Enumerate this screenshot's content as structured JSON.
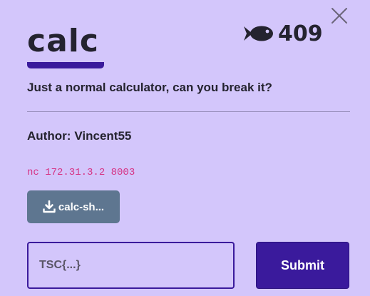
{
  "challenge": {
    "title": "calc",
    "points": "409",
    "points_icon": "fish-icon",
    "description": "Just a normal calculator, can you break it?",
    "author_label": "Author:",
    "author_name": "Vincent55",
    "connection": "nc 172.31.3.2 8003"
  },
  "attachment": {
    "label": "calc-sh...",
    "icon": "download-icon"
  },
  "flag_form": {
    "placeholder": "TSC{...}",
    "value": "",
    "submit_label": "Submit"
  },
  "controls": {
    "close_icon": "close-icon"
  },
  "colors": {
    "background": "#d3c6fb",
    "accent": "#3a1a9c",
    "text": "#24232f",
    "download_button": "#5e7690",
    "connection_text": "#d63384"
  }
}
